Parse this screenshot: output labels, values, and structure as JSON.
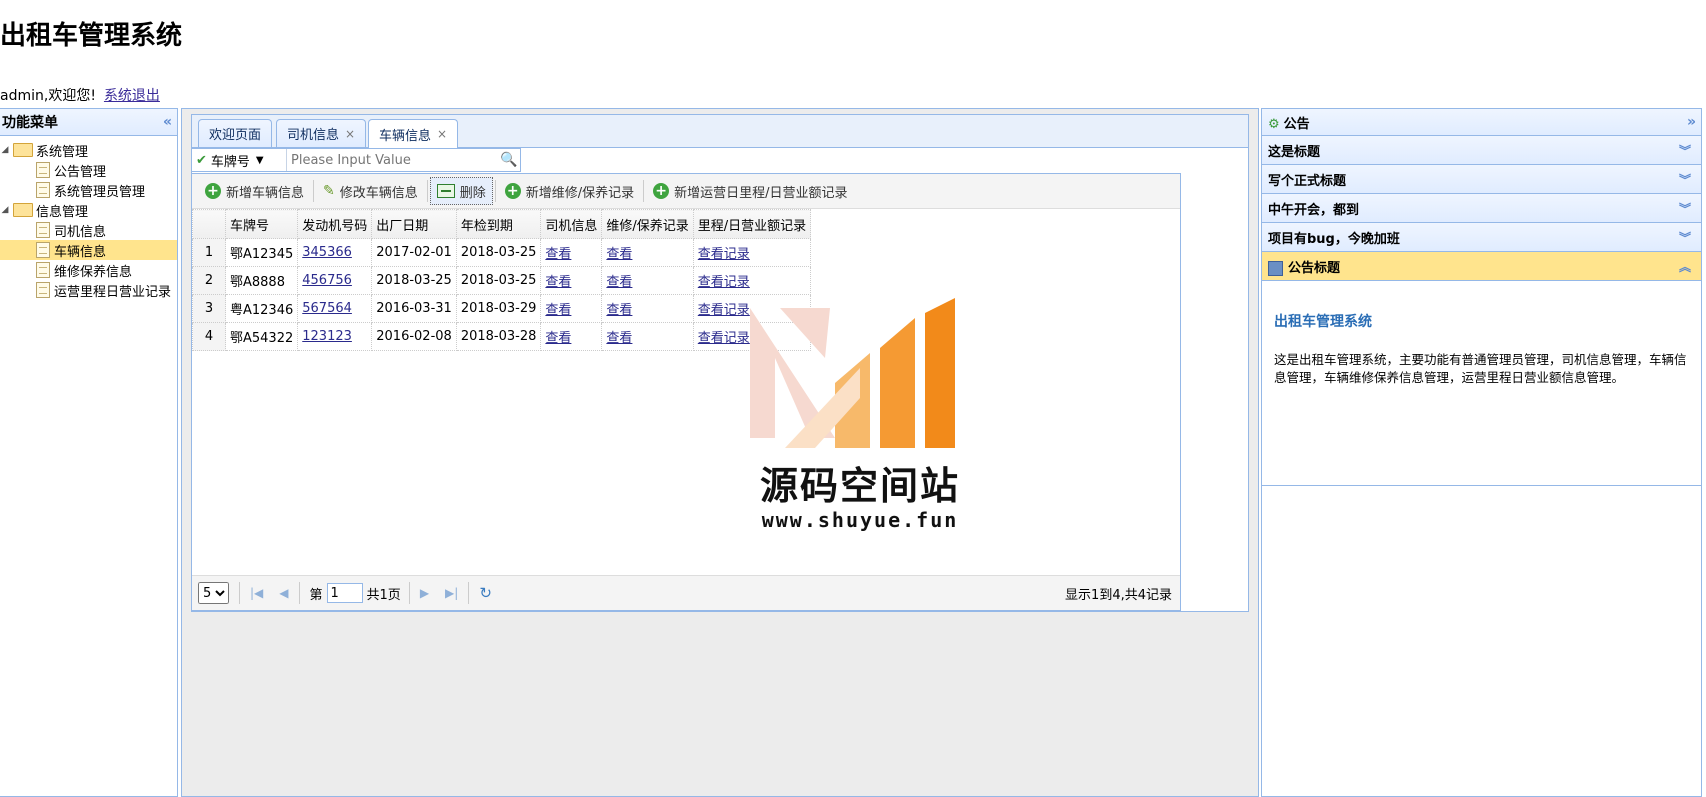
{
  "app": {
    "title": "出租车管理系统",
    "welcome": "admin,欢迎您!",
    "logout": "系统退出"
  },
  "left_menu": {
    "title": "功能菜单",
    "groups": [
      {
        "label": "系统管理",
        "items": [
          "公告管理",
          "系统管理员管理"
        ]
      },
      {
        "label": "信息管理",
        "items": [
          "司机信息",
          "车辆信息",
          "维修保养信息",
          "运营里程日营业记录"
        ]
      }
    ],
    "selected": "车辆信息"
  },
  "tabs": [
    {
      "label": "欢迎页面",
      "closable": false
    },
    {
      "label": "司机信息",
      "closable": true
    },
    {
      "label": "车辆信息",
      "closable": true,
      "active": true
    }
  ],
  "search": {
    "field": "车牌号",
    "placeholder": "Please Input Value"
  },
  "toolbar": {
    "add": "新增车辆信息",
    "edit": "修改车辆信息",
    "delete": "删除",
    "add_maintenance": "新增维修/保养记录",
    "add_mileage": "新增运营日里程/日营业额记录"
  },
  "table": {
    "columns": [
      "车牌号",
      "发动机号码",
      "出厂日期",
      "年检到期",
      "司机信息",
      "维修/保养记录",
      "里程/日营业额记录"
    ],
    "rows": [
      {
        "n": "1",
        "plate": "鄂A12345",
        "engine": "345366",
        "made": "2017-02-01",
        "inspect": "2018-03-25",
        "driver": "查看",
        "maint": "查看",
        "mileage": "查看记录"
      },
      {
        "n": "2",
        "plate": "鄂A8888",
        "engine": "456756",
        "made": "2018-03-25",
        "inspect": "2018-03-25",
        "driver": "查看",
        "maint": "查看",
        "mileage": "查看记录"
      },
      {
        "n": "3",
        "plate": "粤A12346",
        "engine": "567564",
        "made": "2016-03-31",
        "inspect": "2018-03-29",
        "driver": "查看",
        "maint": "查看",
        "mileage": "查看记录"
      },
      {
        "n": "4",
        "plate": "鄂A54322",
        "engine": "123123",
        "made": "2016-02-08",
        "inspect": "2018-03-28",
        "driver": "查看",
        "maint": "查看",
        "mileage": "查看记录"
      }
    ]
  },
  "pager": {
    "page_size": "5",
    "page_prefix": "第",
    "page_value": "1",
    "page_total": "共1页",
    "info": "显示1到4,共4记录"
  },
  "notice": {
    "title": "公告",
    "items": [
      "这是标题",
      "写个正式标题",
      "中午开会，都到",
      "项目有bug，今晚加班"
    ],
    "open_title": "公告标题",
    "content_heading": "出租车管理系统",
    "content_body": "这是出租车管理系统，主要功能有普通管理员管理，司机信息管理，车辆信息管理，车辆维修保养信息管理，运营里程日营业额信息管理。"
  },
  "watermark": {
    "text": "源码空间站",
    "url": "www.shuyue.fun"
  }
}
